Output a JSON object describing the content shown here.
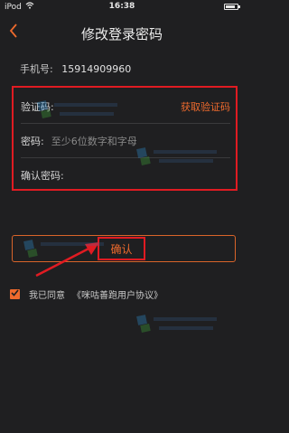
{
  "status_bar": {
    "carrier": "iPod",
    "time": "16:38"
  },
  "nav": {
    "title": "修改登录密码",
    "back_icon": "chevron-left-icon"
  },
  "phone": {
    "label": "手机号:",
    "number": "15914909960"
  },
  "form": {
    "code_label": "验证码:",
    "get_code_label": "获取验证码",
    "password_label": "密码:",
    "password_placeholder": "至少6位数字和字母",
    "confirm_label": "确认密码:"
  },
  "confirm_button": "确认",
  "agreement": {
    "checked": true,
    "text": "我已同意",
    "link": "《咪咕善跑用户协议》"
  },
  "colors": {
    "background": "#1f1f21",
    "accent": "#ee6a2d",
    "highlight": "#e01b22"
  }
}
